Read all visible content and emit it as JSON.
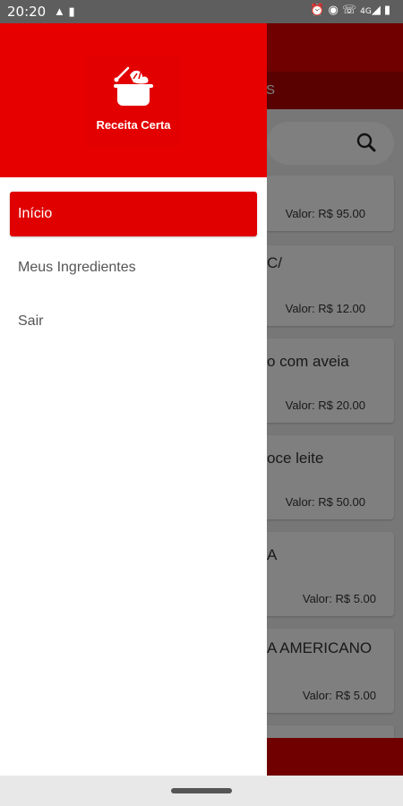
{
  "status_bar": {
    "time": "20:20",
    "left_icons": [
      "notification-icon",
      "phone-icon"
    ],
    "network": "4G",
    "right_icons": [
      "alarm-icon",
      "vibrate-icon",
      "wifi-call-icon",
      "signal-icon",
      "battery-icon"
    ]
  },
  "drawer": {
    "app_name": "Receita Certa",
    "items": [
      {
        "label": "Início",
        "active": true
      },
      {
        "label": "Meus Ingredientes",
        "active": false
      },
      {
        "label": "Sair",
        "active": false
      }
    ]
  },
  "background": {
    "tab_partial": "S",
    "recipes": [
      {
        "name_partial": "",
        "price": "Valor: R$ 95.00"
      },
      {
        "name_partial": "C/",
        "price": "Valor: R$ 12.00"
      },
      {
        "name_partial": "o com aveia",
        "price": "Valor: R$ 20.00"
      },
      {
        "name_partial": "oce leite",
        "price": "Valor: R$ 50.00"
      },
      {
        "name_partial": "A",
        "price": "Valor: R$ 5.00"
      },
      {
        "name_partial": "A AMERICANO",
        "price": "Valor: R$ 5.00"
      }
    ]
  },
  "colors": {
    "primary": "#e60000",
    "status_bar": "#5e5e5e"
  }
}
